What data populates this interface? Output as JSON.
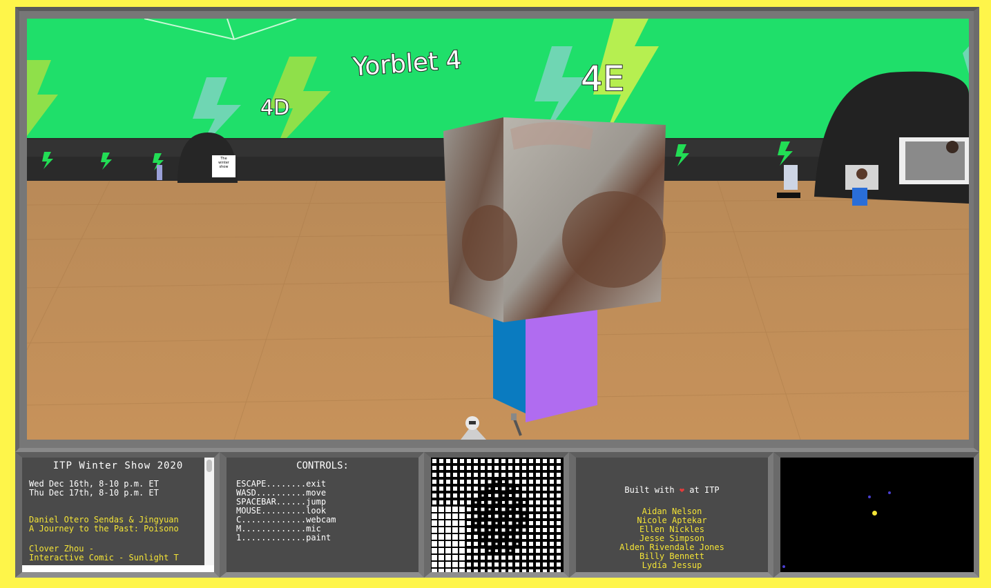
{
  "scene": {
    "room_labels": [
      "Yorblet 4",
      "4D",
      "4E"
    ],
    "sign_text": "The winter show"
  },
  "info_panel": {
    "title": "ITP Winter Show 2020",
    "dates": [
      "Wed Dec 16th, 8-10 p.m. ET",
      "Thu Dec 17th, 8-10 p.m. ET"
    ],
    "projects": [
      {
        "author": "Daniel Otero Sendas & Jingyuan",
        "title": "A Journey to the Past: Poisono"
      },
      {
        "author": "Clover Zhou -",
        "title": "Interactive Comic - Sunlight T"
      }
    ]
  },
  "controls_panel": {
    "title": "CONTROLS:",
    "rows": [
      {
        "key": "ESCAPE",
        "action": "exit"
      },
      {
        "key": "WASD",
        "action": "move"
      },
      {
        "key": "SPACEBAR",
        "action": "jump"
      },
      {
        "key": "MOUSE",
        "action": "look"
      },
      {
        "key": "C",
        "action": "webcam"
      },
      {
        "key": "M",
        "action": "mic"
      },
      {
        "key": "1",
        "action": "paint"
      }
    ]
  },
  "credits_panel": {
    "built_prefix": "Built with",
    "built_suffix": "at ITP",
    "heart_icon": "heart-icon",
    "names": [
      "Aidan Nelson",
      "Nicole Aptekar",
      "Ellen Nickles",
      "Jesse Simpson",
      "Alden Rivendale Jones",
      "Billy Bennett",
      "Lydia Jessup"
    ]
  },
  "minimap": {
    "player_color": "#f4e436",
    "others_color": "#4a3fd0"
  },
  "colors": {
    "background": "#fef54a",
    "sky": "#1fdf6a",
    "floor": "#c8935a",
    "accent_yellow": "#f4e436"
  }
}
